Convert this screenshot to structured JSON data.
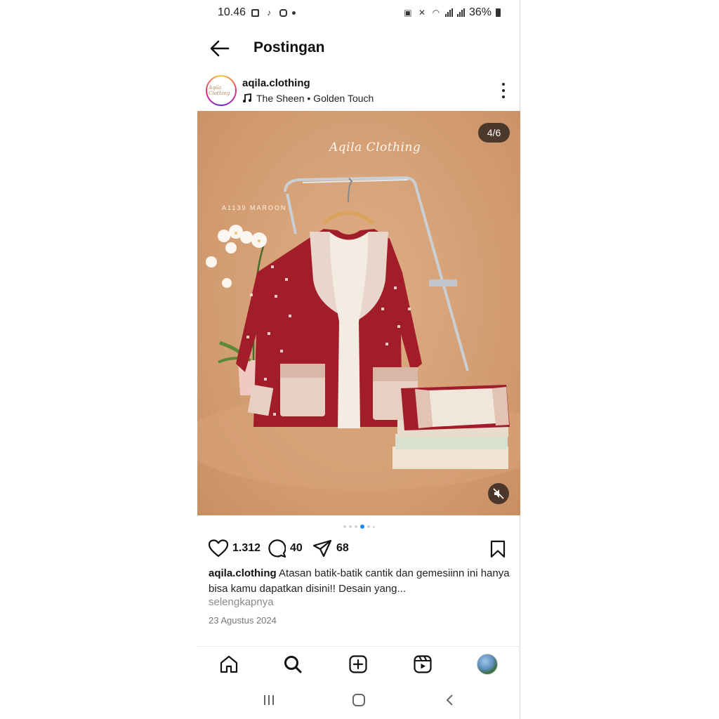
{
  "status_bar": {
    "time": "10.46",
    "battery": "36%"
  },
  "header": {
    "title": "Postingan"
  },
  "post": {
    "username": "aqila.clothing",
    "avatar_text": "Aqila Clothing",
    "music": "The Sheen • Golden Touch",
    "slide_counter": "4/6",
    "image": {
      "brand_logo": "Aqila Clothing",
      "product_code": "A1139 MAROON"
    },
    "likes": "1.312",
    "comments": "40",
    "shares": "68",
    "caption_username": "aqila.clothing",
    "caption_text": "Atasan batik-batik cantik dan gemesiinn ini hanya bisa kamu dapatkan disini!! Desain yang...",
    "more_label": "selengkapnya",
    "date": "23 Agustus 2024"
  },
  "colors": {
    "accent_dot": "#1a8cff",
    "image_bg": "#d39d72",
    "maroon": "#a11d2a"
  },
  "icons": {
    "back": "arrow-left-icon",
    "more": "more-vertical-icon",
    "music": "music-note-icon",
    "like": "heart-icon",
    "comment": "comment-icon",
    "share": "send-icon",
    "save": "bookmark-icon",
    "mute": "speaker-muted-icon",
    "home": "home-icon",
    "search": "search-icon",
    "create": "plus-square-icon",
    "reels": "reels-icon"
  }
}
